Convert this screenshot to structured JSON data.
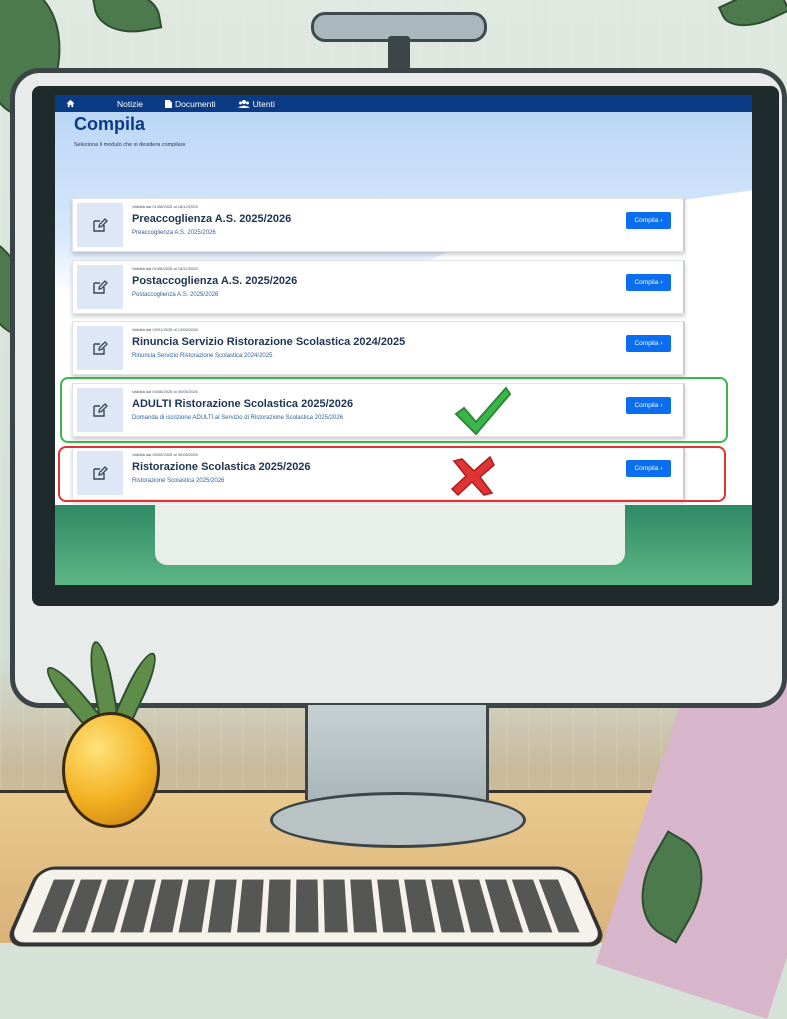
{
  "nav": {
    "home_icon": "home-icon",
    "items": [
      {
        "label": "Notizie",
        "icon": ""
      },
      {
        "label": "Documenti",
        "icon": "document-icon"
      },
      {
        "label": "Utenti",
        "icon": "users-icon"
      }
    ]
  },
  "page": {
    "title": "Compila",
    "subtitle": "Seleziona il modulo che si desidera compilare"
  },
  "cards": [
    {
      "validity": "Validità dal 01/08/2025 al 18/12/2025",
      "title": "Preaccoglienza A.S. 2025/2026",
      "description": "Preaccoglienza A.S. 2025/2026",
      "button": "Compila"
    },
    {
      "validity": "Validità dal 01/08/2025 al 18/12/2025",
      "title": "Postaccoglienza A.S. 2025/2026",
      "description": "Postaccoglienza A.S. 2025/2026",
      "button": "Compila"
    },
    {
      "validity": "Validità dal 03/01/2025 al 13/06/2026",
      "title": "Rinuncia Servizio Ristorazione Scolastica 2024/2025",
      "description": "Rinuncia Servizio Ristorazione Scolastica 2024/2025",
      "button": "Compila"
    },
    {
      "validity": "Validità dal 04/08/2025 al 30/06/2026",
      "title": "ADULTI Ristorazione Scolastica 2025/2026",
      "description": "Domanda di iscrizione ADULTI al Servizio di Ristorazione Scolastica 2025/2026",
      "button": "Compila"
    },
    {
      "validity": "Validità dal 26/05/2025 al 30/06/2026",
      "title": "Ristorazione Scolastica 2025/2026",
      "description": "Ristorazione Scolastica 2025/2026",
      "button": "Compila"
    }
  ],
  "annotations": {
    "correct_color": "#3cb54a",
    "wrong_color": "#e03434"
  },
  "colors": {
    "nav_bg": "#0b3b84",
    "button_bg": "#0b6df0",
    "title_color": "#1d3456"
  }
}
